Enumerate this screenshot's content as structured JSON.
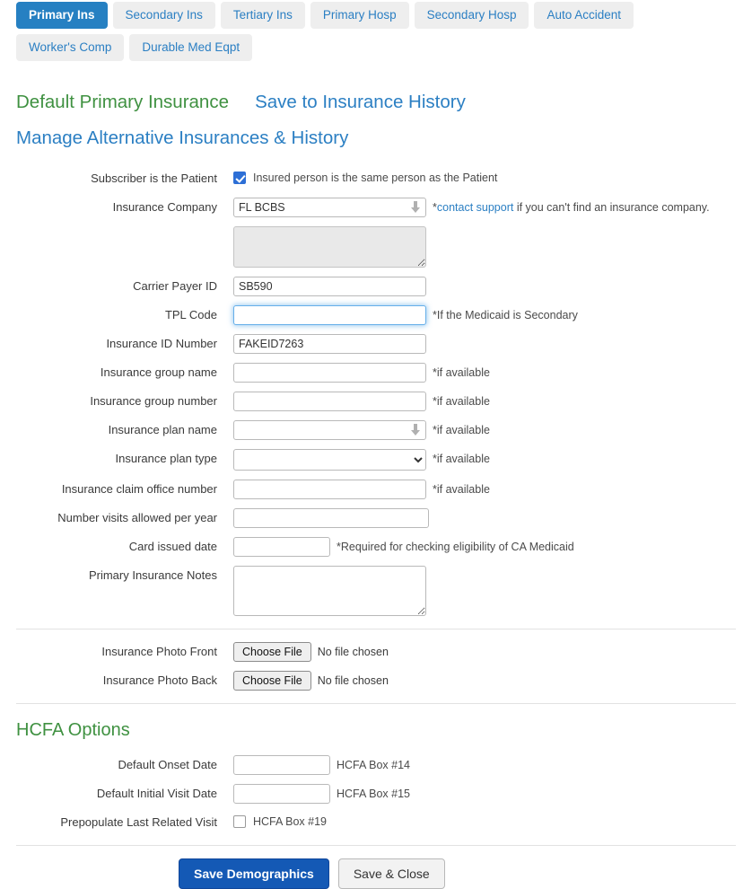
{
  "tabs": [
    {
      "label": "Primary Ins",
      "active": true
    },
    {
      "label": "Secondary Ins",
      "active": false
    },
    {
      "label": "Tertiary Ins",
      "active": false
    },
    {
      "label": "Primary Hosp",
      "active": false
    },
    {
      "label": "Secondary Hosp",
      "active": false
    },
    {
      "label": "Auto Accident",
      "active": false
    },
    {
      "label": "Worker's Comp",
      "active": false
    },
    {
      "label": "Durable Med Eqpt",
      "active": false
    }
  ],
  "header": {
    "title": "Default Primary Insurance",
    "save_history_link": "Save to Insurance History",
    "manage_link": "Manage Alternative Insurances & History"
  },
  "colors": {
    "accent_blue": "#2680c2",
    "primary_button": "#1459b5",
    "green": "#3f9141",
    "link_blue": "#2b7fc3"
  },
  "form": {
    "subscriber": {
      "label": "Subscriber is the Patient",
      "checkbox_text": "Insured person is the same person as the Patient",
      "checked": true
    },
    "insurance_company": {
      "label": "Insurance Company",
      "value": "FL BCBS",
      "placeholder": "",
      "hint_prefix": "*",
      "hint_link": "contact support",
      "hint_suffix": " if you can't find an insurance company."
    },
    "company_address": {
      "label": "",
      "value": "",
      "placeholder": "",
      "disabled": true
    },
    "carrier_payer_id": {
      "label": "Carrier Payer ID",
      "value": "SB590",
      "placeholder": ""
    },
    "tpl_code": {
      "label": "TPL Code",
      "value": "",
      "placeholder": "",
      "hint": "*If the Medicaid is Secondary",
      "focused": true
    },
    "insurance_id_number": {
      "label": "Insurance ID Number",
      "value": "FAKEID7263",
      "placeholder": ""
    },
    "group_name": {
      "label": "Insurance group name",
      "value": "",
      "placeholder": "",
      "hint": "*if available"
    },
    "group_number": {
      "label": "Insurance group number",
      "value": "",
      "placeholder": "",
      "hint": "*if available"
    },
    "plan_name": {
      "label": "Insurance plan name",
      "value": "",
      "placeholder": "",
      "hint": "*if available"
    },
    "plan_type": {
      "label": "Insurance plan type",
      "value": "",
      "options": [
        ""
      ],
      "hint": "*if available"
    },
    "claim_office_number": {
      "label": "Insurance claim office number",
      "value": "",
      "placeholder": "",
      "hint": "*if available"
    },
    "visits_allowed": {
      "label": "Number visits allowed per year",
      "value": "",
      "placeholder": ""
    },
    "card_issued_date": {
      "label": "Card issued date",
      "value": "",
      "placeholder": "",
      "hint": "*Required for checking eligibility of CA Medicaid"
    },
    "notes": {
      "label": "Primary Insurance Notes",
      "value": "",
      "placeholder": ""
    },
    "photo_front": {
      "label": "Insurance Photo Front",
      "button_label": "Choose File",
      "file_status": "No file chosen"
    },
    "photo_back": {
      "label": "Insurance Photo Back",
      "button_label": "Choose File",
      "file_status": "No file chosen"
    }
  },
  "hcfa": {
    "title": "HCFA Options",
    "onset_date": {
      "label": "Default Onset Date",
      "value": "",
      "placeholder": "",
      "hint": "HCFA Box #14"
    },
    "initial_visit_date": {
      "label": "Default Initial Visit Date",
      "value": "",
      "placeholder": "",
      "hint": "HCFA Box #15"
    },
    "prepopulate_last_visit": {
      "label": "Prepopulate Last Related Visit",
      "checkbox_text": "HCFA Box #19",
      "checked": false
    }
  },
  "footer": {
    "save_demographics": "Save Demographics",
    "save_and_close": "Save & Close"
  }
}
